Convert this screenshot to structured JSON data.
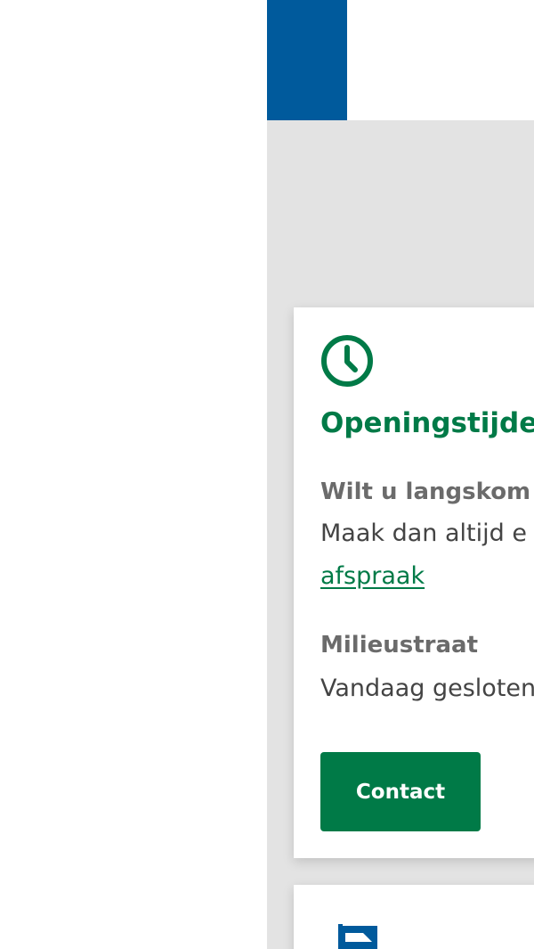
{
  "header": {
    "brand_color": "#005a9c"
  },
  "card": {
    "icon": "clock-icon",
    "title": "Openingstijde",
    "visit_label": "Wilt u langskom",
    "visit_text": "Maak dan altijd e",
    "visit_link": "afspraak",
    "milieustraat_label": "Milieustraat",
    "milieustraat_status": "Vandaag gesloten",
    "contact_button": "Contact"
  },
  "card2": {
    "icon": "flag-icon"
  },
  "colors": {
    "accent": "#007a47",
    "page_bg": "#e3e3e3",
    "brand_blue": "#005a9c",
    "label_gray": "#6b6b6b",
    "text_gray": "#444444"
  }
}
